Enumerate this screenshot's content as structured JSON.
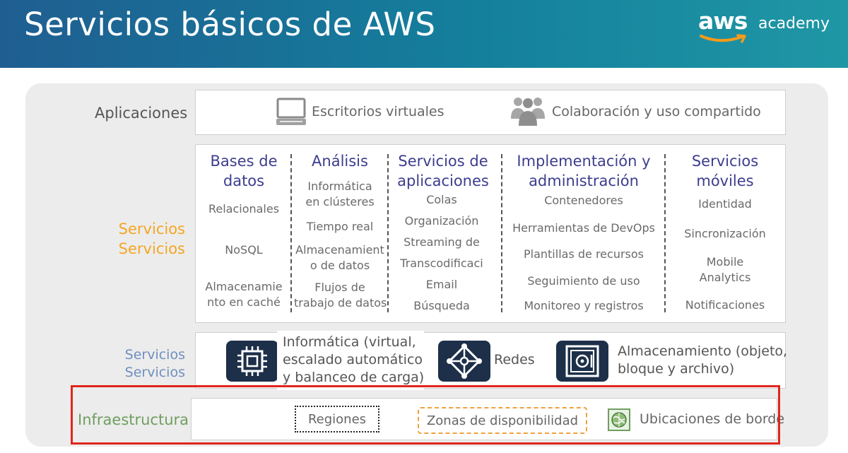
{
  "header": {
    "title": "Servicios básicos de AWS"
  },
  "logo": {
    "brand": "aws",
    "product": "academy"
  },
  "applications": {
    "label": "Aplicaciones",
    "items": [
      {
        "icon": "desktop-icon",
        "text": "Escritorios virtuales"
      },
      {
        "icon": "people-icon",
        "text": "Colaboración y uso compartido"
      }
    ]
  },
  "services": {
    "label_line1": "Servicios",
    "label_line2": "Servicios",
    "categories": [
      {
        "title": [
          "Bases de",
          "datos"
        ],
        "items": [
          "Relacionales",
          "NoSQL",
          "Almacenamie",
          "nto en caché"
        ]
      },
      {
        "title": [
          "Análisis"
        ],
        "items": [
          "Informática",
          "en clústeres",
          "Tiempo real",
          "Almacenamient",
          "o de datos",
          "Flujos de",
          "trabajo de datos"
        ]
      },
      {
        "title": [
          "Servicios de",
          "aplicaciones"
        ],
        "items": [
          "Colas",
          "Organización",
          "Streaming de",
          "Transcodificaci",
          "Email",
          "Búsqueda"
        ]
      },
      {
        "title": [
          "Implementación y",
          "administración"
        ],
        "items": [
          "Contenedores",
          "Herramientas de DevOps",
          "Plantillas de recursos",
          "Seguimiento de uso",
          "Monitoreo y registros"
        ]
      },
      {
        "title": [
          "Servicios",
          "móviles"
        ],
        "items": [
          "Identidad",
          "Sincronización",
          "Mobile",
          "Analytics",
          "Notificaciones"
        ]
      }
    ]
  },
  "foundation": {
    "label_line1": "Servicios",
    "label_line2": "Servicios",
    "items": [
      {
        "icon": "chip-icon",
        "lines": [
          "Informática (virtual,",
          "escalado automático",
          "y balanceo de carga)"
        ]
      },
      {
        "icon": "network-icon",
        "lines": [
          "Redes"
        ]
      },
      {
        "icon": "vault-icon",
        "lines": [
          "Almacenamiento (objeto,",
          "bloque y archivo)"
        ]
      }
    ]
  },
  "infrastructure": {
    "label": "Infraestructura",
    "regions": "Regiones",
    "zones": "Zonas de disponibilidad",
    "edge": "Ubicaciones de borde"
  },
  "colors": {
    "header_start": "#1f5e91",
    "header_end": "#1f97a5",
    "category_title": "#3d3d8f",
    "services_label": "#f5a623",
    "foundation_label": "#6f8fc0",
    "infrastructure_label": "#6f9e5f",
    "highlight_frame": "#e0261c",
    "zones_border": "#f0a040"
  }
}
